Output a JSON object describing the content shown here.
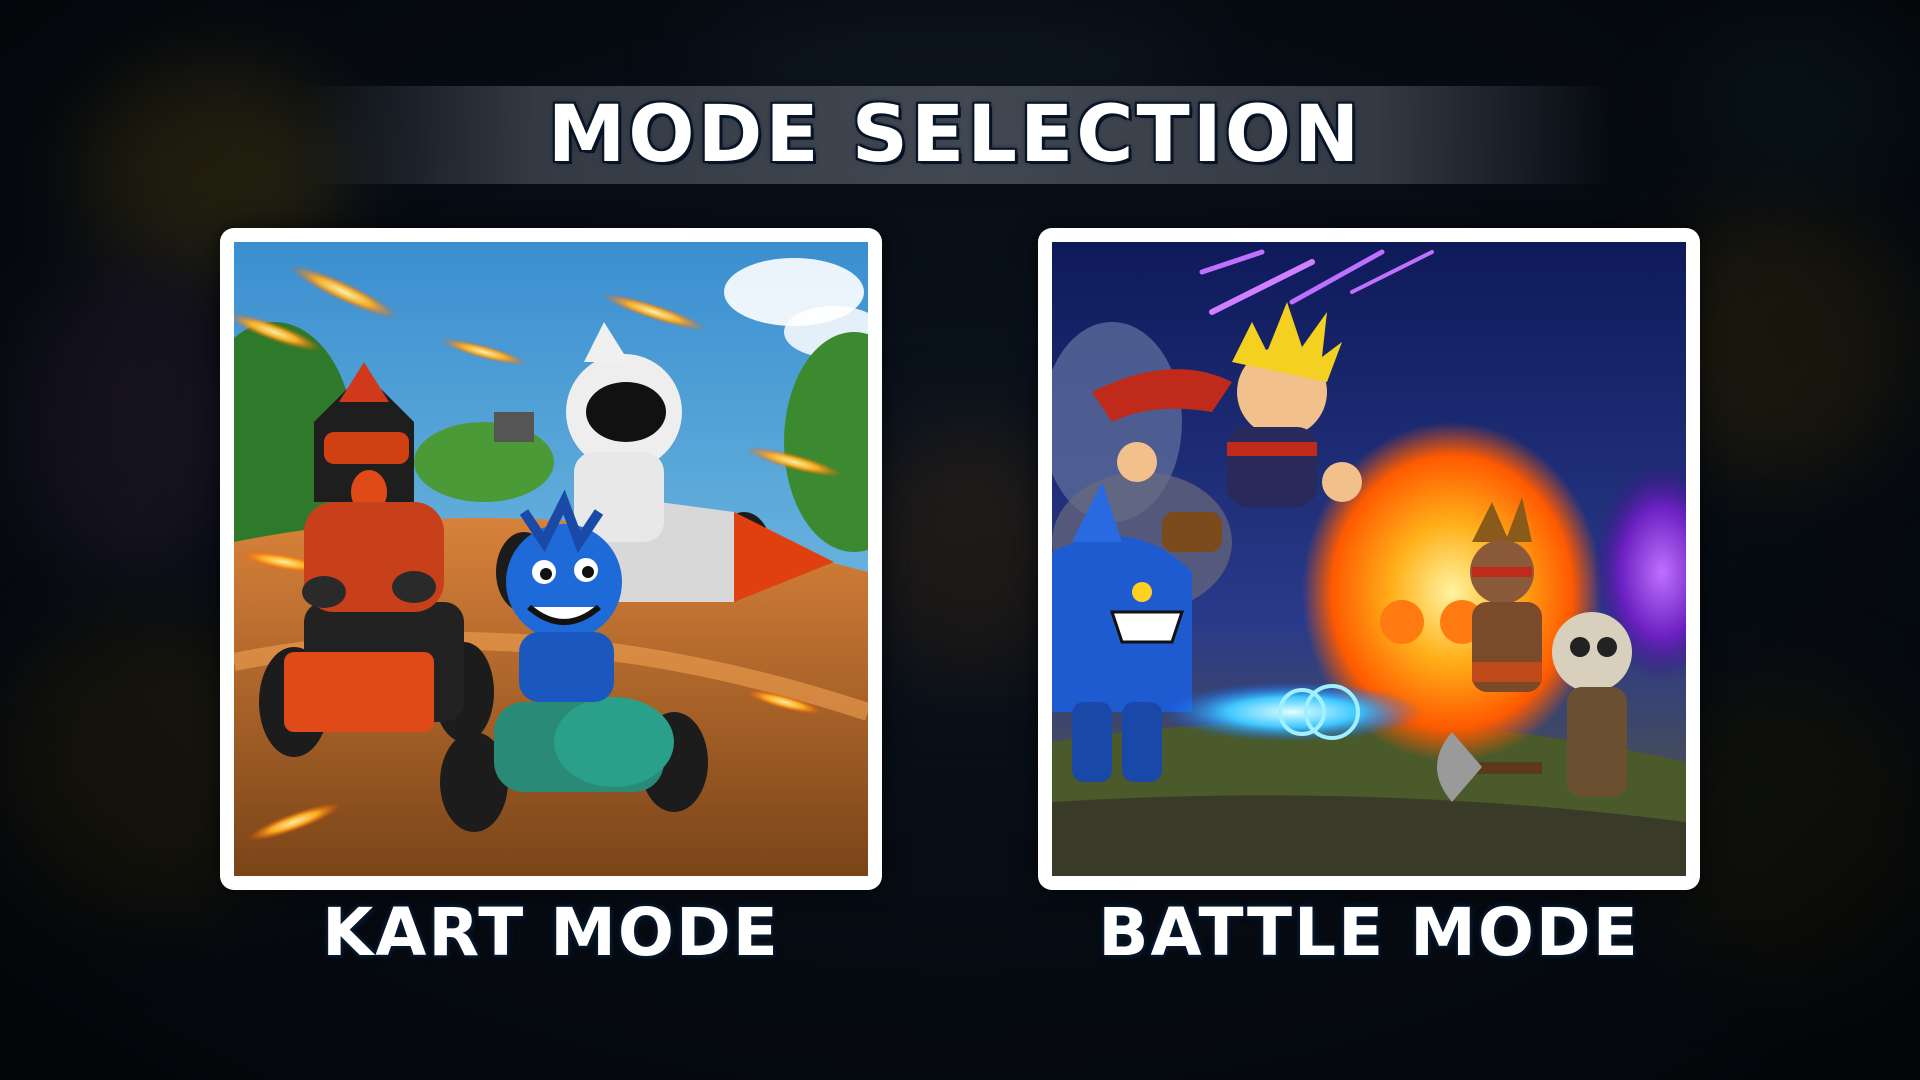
{
  "screen": {
    "title": "MODE SELECTION"
  },
  "modes": [
    {
      "label": "KART MODE",
      "art": "kart-racing-illustration"
    },
    {
      "label": "BATTLE MODE",
      "art": "battle-illustration"
    }
  ],
  "colors": {
    "card_border": "#ffffff",
    "text": "#ffffff",
    "text_outline": "#061222"
  }
}
